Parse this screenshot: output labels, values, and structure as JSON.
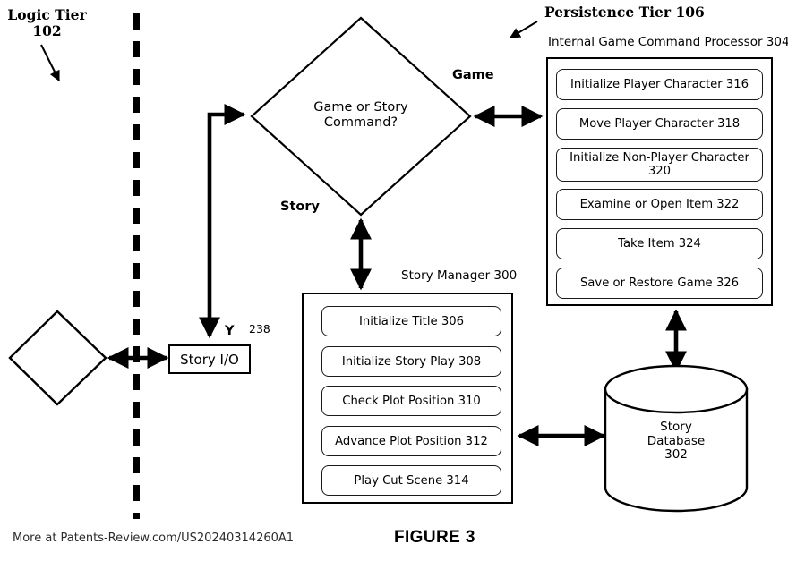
{
  "figure": {
    "caption": "FIGURE 3",
    "watermark": "More at Patents-Review.com/US20240314260A1"
  },
  "tiers": {
    "logic": {
      "title_line1": "Logic Tier",
      "title_line2": "102"
    },
    "persistence": {
      "title": "Persistence Tier 106"
    }
  },
  "decision": {
    "line1": "Game or Story",
    "line2": "Command?",
    "branch_game": "Game",
    "branch_story": "Story"
  },
  "story_io": {
    "label": "Story I/O",
    "yes_label": "Y",
    "ref": "238"
  },
  "story_manager": {
    "caption": "Story Manager 300",
    "items": [
      {
        "label": "Initialize Title 306"
      },
      {
        "label": "Initialize Story Play 308"
      },
      {
        "label": "Check Plot Position 310"
      },
      {
        "label": "Advance Plot Position 312"
      },
      {
        "label": "Play Cut Scene 314"
      }
    ]
  },
  "game_command_processor": {
    "caption": "Internal Game Command Processor 304",
    "items": [
      {
        "label": "Initialize Player Character 316"
      },
      {
        "label": "Move Player Character 318"
      },
      {
        "label": "Initialize Non-Player Character 320"
      },
      {
        "label": "Examine or Open Item 322"
      },
      {
        "label": "Take Item 324"
      },
      {
        "label": "Save or Restore Game 326"
      }
    ]
  },
  "story_database": {
    "line1": "Story",
    "line2": "Database",
    "line3": "302"
  },
  "colors": {
    "stroke": "#000000",
    "fill": "#ffffff",
    "box_stroke": "#1a1a1a"
  }
}
